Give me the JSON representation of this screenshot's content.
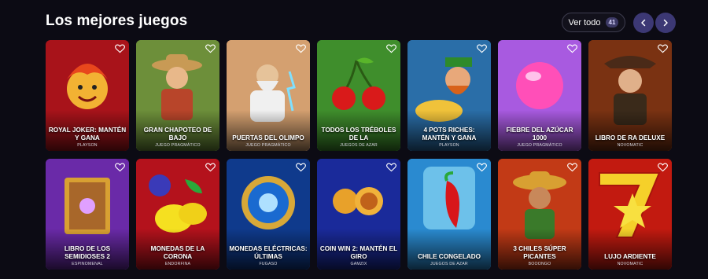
{
  "header": {
    "title": "Los mejores juegos",
    "view_all_label": "Ver todo",
    "total_count": "41",
    "prev_icon": "chevron-left-icon",
    "next_icon": "chevron-right-icon"
  },
  "colors": {
    "background": "#0c0b14",
    "nav_button": "#3c3874",
    "badge": "#3d3a66"
  },
  "rows": [
    [
      {
        "name": "ROYAL JOKER: MANTÉN Y GANA",
        "provider": "PLAYSON",
        "bg": "#a8131a"
      },
      {
        "name": "GRAN CHAPOTEO DE BAJO",
        "provider": "JUEGO PRAGMÁTICO",
        "bg": "#5d7a2e"
      },
      {
        "name": "PUERTAS DEL OLIMPO",
        "provider": "JUEGO PRAGMÁTICO",
        "bg": "#c98a5b"
      },
      {
        "name": "TODOS LOS TRÉBOLES DE LA",
        "provider": "JUEGOS DE AZAR",
        "bg": "#3f8e2c"
      },
      {
        "name": "4 POTS RICHES: MANTÉN Y GANA",
        "provider": "PLAYSON",
        "bg": "#2a6ea8"
      },
      {
        "name": "FIEBRE DEL AZÚCAR 1000",
        "provider": "JUEGO PRAGMÁTICO",
        "bg": "#9c4fd0"
      },
      {
        "name": "LIBRO DE RA DELUXE",
        "provider": "NOVOMATIC",
        "bg": "#8a3a12"
      }
    ],
    [
      {
        "name": "LIBRO DE LOS SEMIDIOSES 2",
        "provider": "ESPINOMENAL",
        "bg": "#6a2aa8"
      },
      {
        "name": "MONEDAS DE LA CORONA",
        "provider": "ENDORFINA",
        "bg": "#b4121c"
      },
      {
        "name": "MONEDAS ELÉCTRICAS: ÚLTIMAS",
        "provider": "FUGASO",
        "bg": "#0f3a8c"
      },
      {
        "name": "COIN WIN 2: MANTÉN EL GIRO",
        "provider": "GAMZIX",
        "bg": "#1a2a9a"
      },
      {
        "name": "CHILE CONGELADO",
        "provider": "JUEGOS DE AZAR",
        "bg": "#2a8ad0"
      },
      {
        "name": "3 CHILES SÚPER PICANTES",
        "provider": "BOOONGO",
        "bg": "#c23a16"
      },
      {
        "name": "LUJO ARDIENTE",
        "provider": "NOVOMATIC",
        "bg": "#c21a10"
      }
    ]
  ]
}
